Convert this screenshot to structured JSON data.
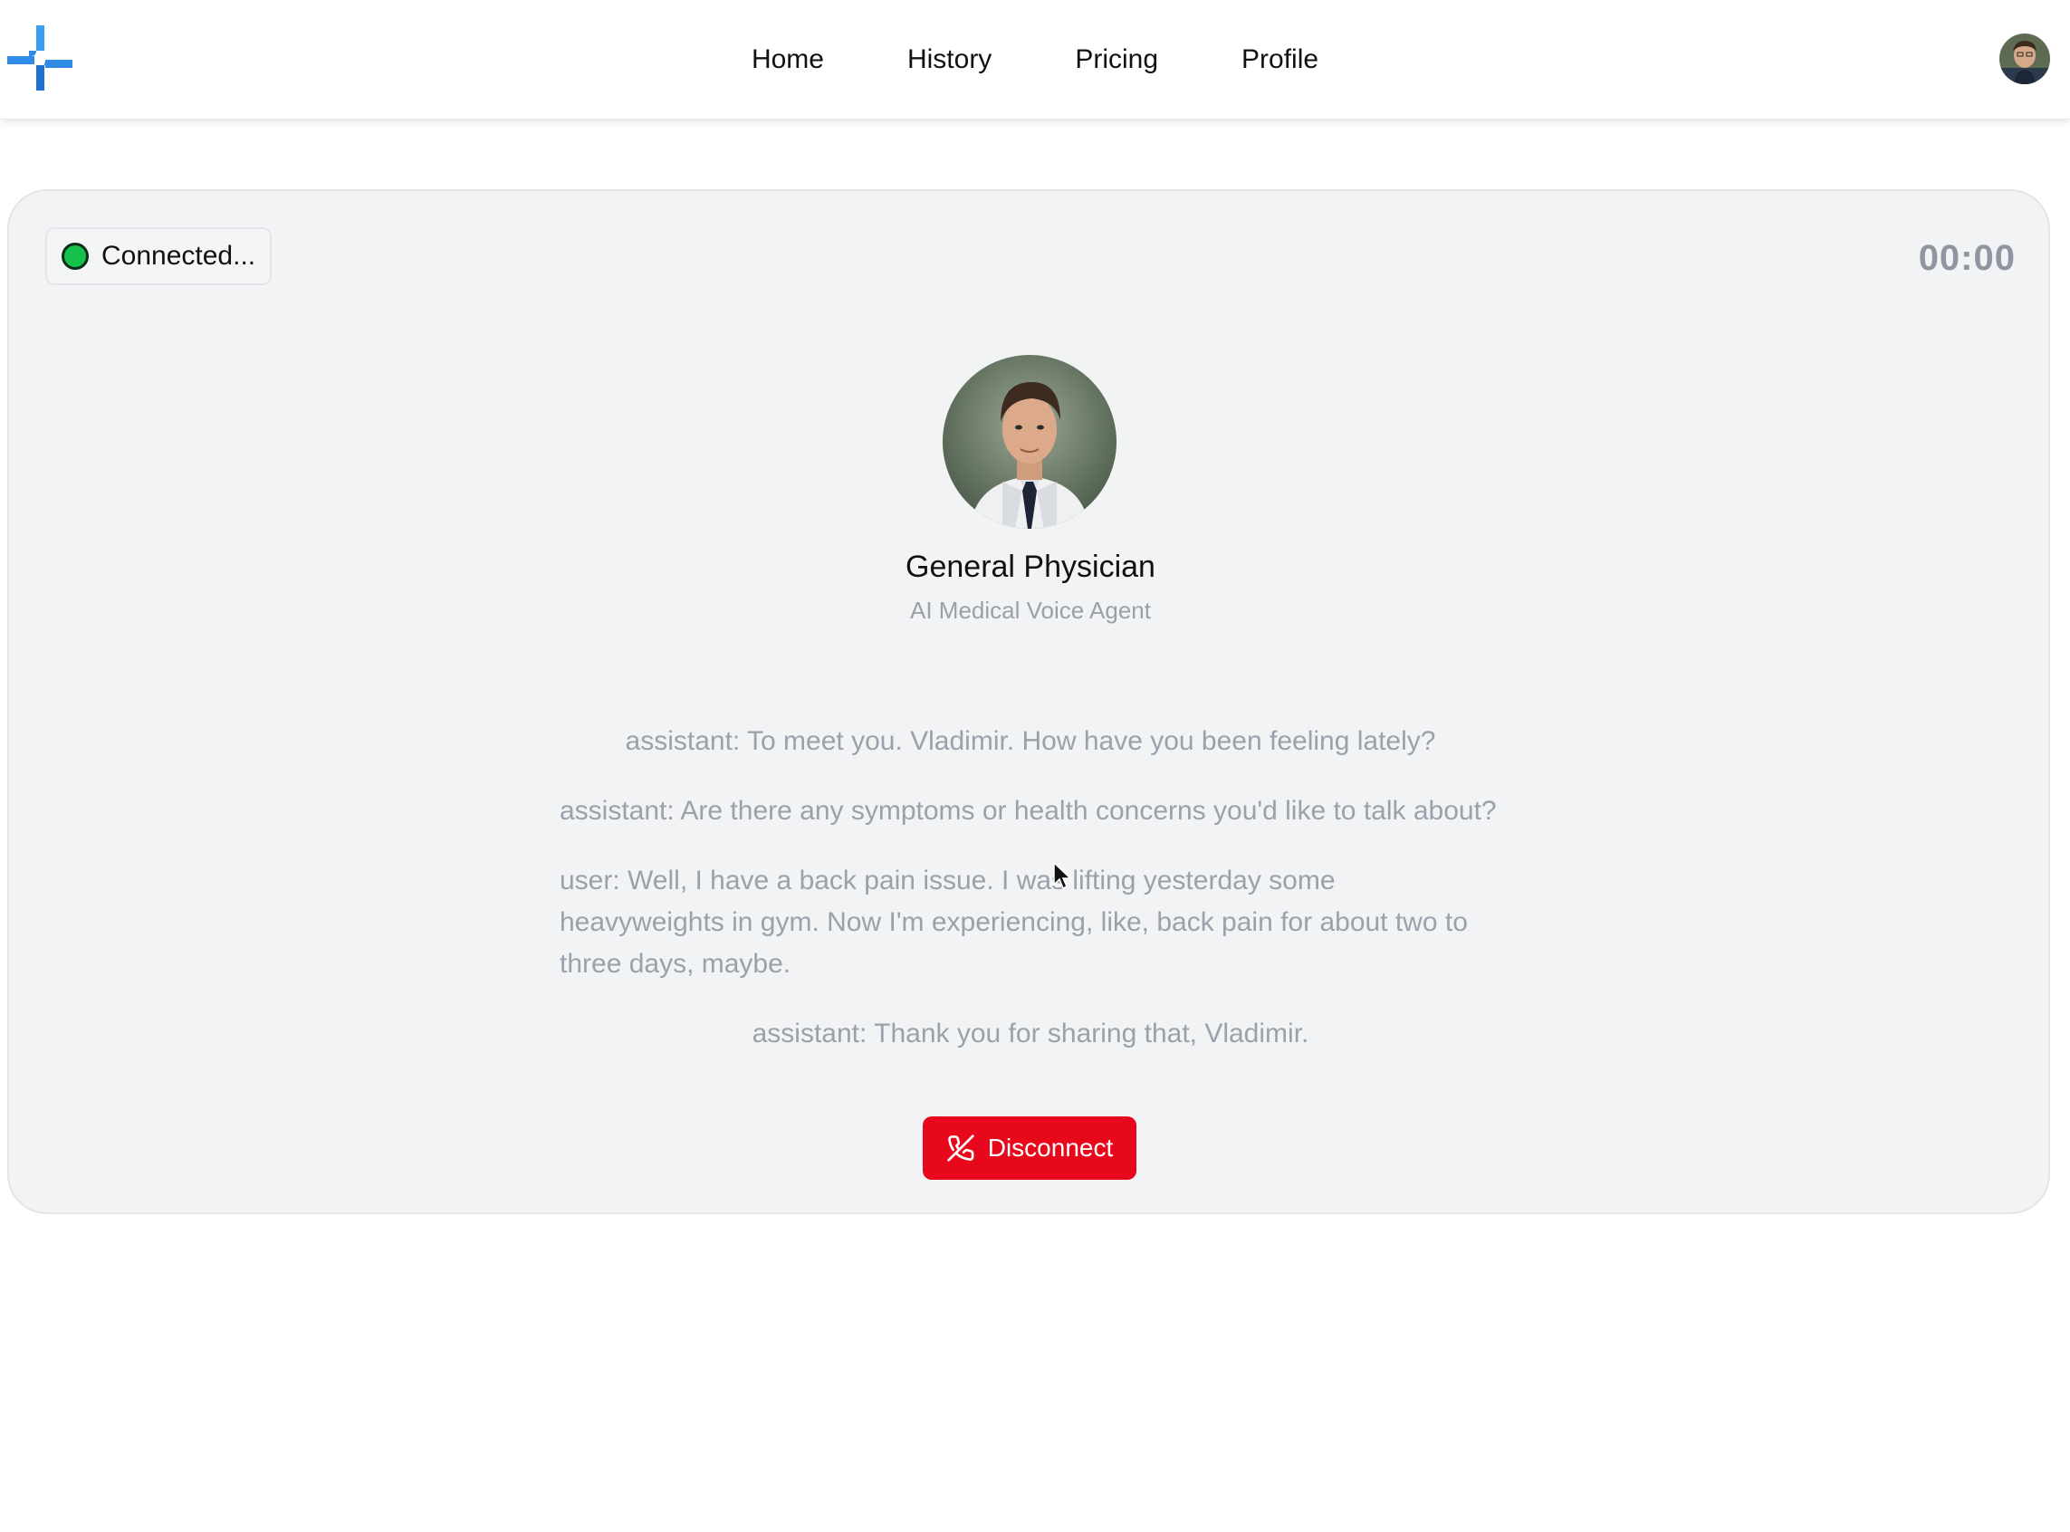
{
  "header": {
    "logo_icon": "medical-cross-logo-icon",
    "nav_items": [
      {
        "label": "Home"
      },
      {
        "label": "History"
      },
      {
        "label": "Pricing"
      },
      {
        "label": "Profile"
      }
    ],
    "user_avatar_icon": "user-avatar-icon"
  },
  "call": {
    "status_text": "Connected...",
    "status_color": "#16c04a",
    "timer": "00:00",
    "agent": {
      "name": "General Physician",
      "subtitle": "AI Medical Voice Agent",
      "photo_icon": "doctor-portrait-icon"
    },
    "transcript": [
      {
        "text": "assistant: To meet you. Vladimir. How have you been feeling lately?"
      },
      {
        "text": "assistant: Are there any symptoms or health concerns you'd like to talk about?"
      },
      {
        "text": "user: Well, I have a back pain issue. I was lifting yesterday some heavyweights in gym. Now I'm experiencing, like, back pain for about two to three days, maybe."
      },
      {
        "text": "assistant: Thank you for sharing that, Vladimir."
      }
    ],
    "disconnect_label": "Disconnect",
    "disconnect_icon": "phone-off-icon",
    "disconnect_color": "#e8081b"
  },
  "colors": {
    "accent": "#2f8be6",
    "card_bg": "#f2f3f5",
    "muted_text": "#9aa1ab"
  }
}
